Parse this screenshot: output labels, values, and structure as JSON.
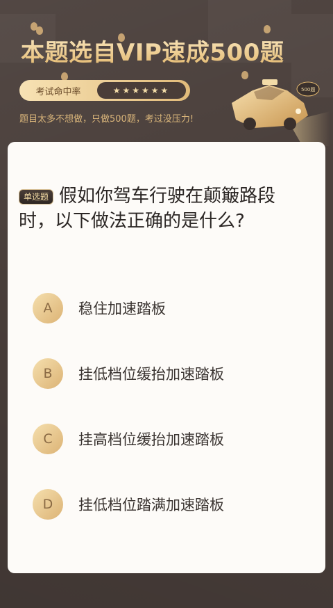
{
  "header": {
    "title": "本题选自VIP速成500题",
    "rate_label": "考试命中率",
    "stars": "★★★★★★",
    "subtitle": "题目太多不想做，只做500题，考过没压力!",
    "sign_text": "500题"
  },
  "question": {
    "tag": "单选题",
    "text": "假如你驾车行驶在颠簸路段时，以下做法正确的是什么?"
  },
  "options": [
    {
      "letter": "A",
      "text": "稳住加速踏板"
    },
    {
      "letter": "B",
      "text": "挂低档位缓抬加速踏板"
    },
    {
      "letter": "C",
      "text": "挂高档位缓抬加速踏板"
    },
    {
      "letter": "D",
      "text": "挂低档位踏满加速踏板"
    }
  ],
  "colors": {
    "background": "#4b403c",
    "gold": "#e3b86e",
    "card": "#fdfbf8"
  }
}
